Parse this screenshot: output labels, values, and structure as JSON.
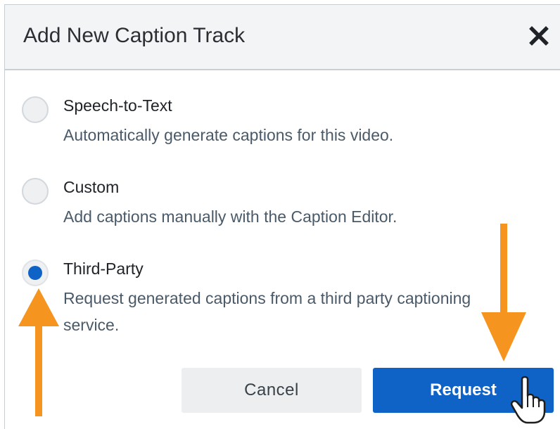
{
  "dialog": {
    "title": "Add New Caption Track",
    "close_icon": "close-icon"
  },
  "options": [
    {
      "label": "Speech-to-Text",
      "description": "Automatically generate captions for this video.",
      "selected": false
    },
    {
      "label": "Custom",
      "description": "Add captions manually with the Caption Editor.",
      "selected": false
    },
    {
      "label": "Third-Party",
      "description": "Request generated captions from a third party captioning service.",
      "selected": true
    }
  ],
  "buttons": {
    "cancel_label": "Cancel",
    "request_label": "Request"
  },
  "colors": {
    "accent": "#0f63c7",
    "annotation_arrow": "#f5941e",
    "header_bg": "#f2f4f5"
  },
  "annotations": {
    "arrow_icon": "orange-arrow-icon",
    "cursor_icon": "hand-pointer-icon"
  }
}
